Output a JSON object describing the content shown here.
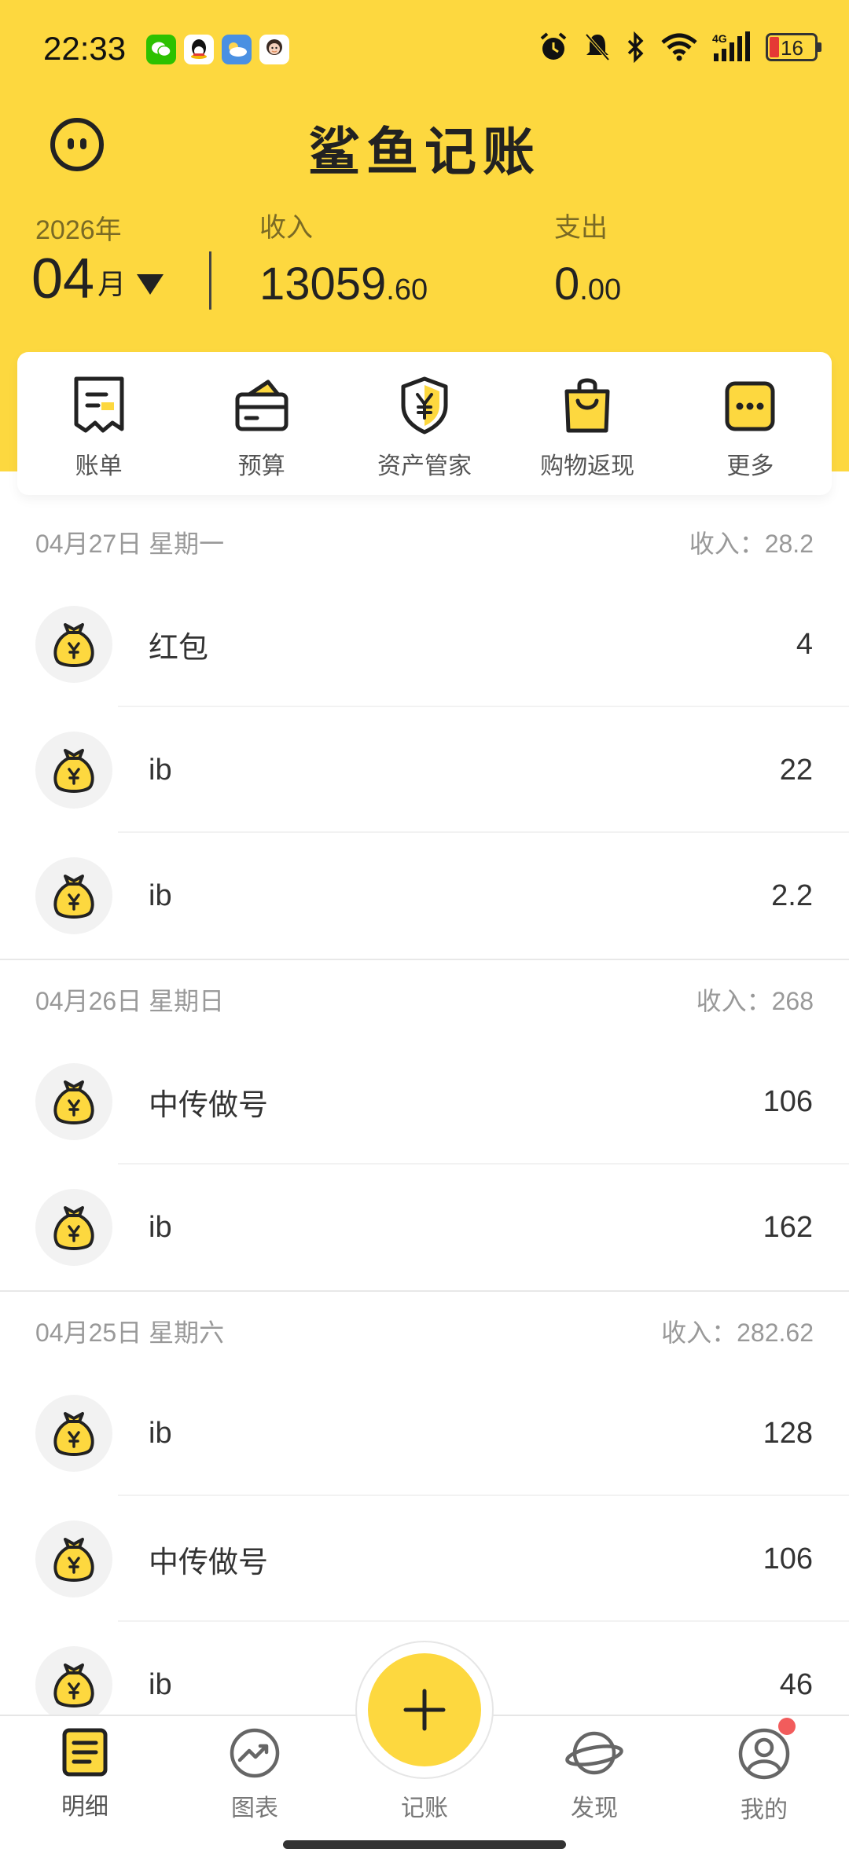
{
  "status_bar": {
    "time": "22:33",
    "network": "4G",
    "battery": "16"
  },
  "header": {
    "title": "鲨鱼记账",
    "year": "2026年",
    "month": "04",
    "month_unit": "月",
    "income_label": "收入",
    "income_int": "13059",
    "income_dec": ".60",
    "expense_label": "支出",
    "expense_int": "0",
    "expense_dec": ".00"
  },
  "quick_actions": [
    {
      "label": "账单",
      "icon": "bill-icon"
    },
    {
      "label": "预算",
      "icon": "wallet-icon"
    },
    {
      "label": "资产管家",
      "icon": "shield-yen-icon"
    },
    {
      "label": "购物返现",
      "icon": "shopping-bag-icon"
    },
    {
      "label": "更多",
      "icon": "more-icon"
    }
  ],
  "days": [
    {
      "date": "04月27日 星期一",
      "summary": "收入：28.2",
      "items": [
        {
          "name": "红包",
          "amount": "4"
        },
        {
          "name": "ib",
          "amount": "22"
        },
        {
          "name": "ib",
          "amount": "2.2"
        }
      ]
    },
    {
      "date": "04月26日 星期日",
      "summary": "收入：268",
      "items": [
        {
          "name": "中传做号",
          "amount": "106"
        },
        {
          "name": "ib",
          "amount": "162"
        }
      ]
    },
    {
      "date": "04月25日 星期六",
      "summary": "收入：282.62",
      "items": [
        {
          "name": "ib",
          "amount": "128"
        },
        {
          "name": "中传做号",
          "amount": "106"
        },
        {
          "name": "ib",
          "amount": "46"
        }
      ]
    }
  ],
  "nav": [
    {
      "label": "明细",
      "icon": "detail-icon",
      "active": true
    },
    {
      "label": "图表",
      "icon": "chart-icon"
    },
    {
      "label": "记账",
      "icon": "plus-icon"
    },
    {
      "label": "发现",
      "icon": "planet-icon"
    },
    {
      "label": "我的",
      "icon": "profile-icon"
    }
  ],
  "colors": {
    "brand_yellow": "#FDD83F",
    "badge_red": "#F25C5C"
  }
}
